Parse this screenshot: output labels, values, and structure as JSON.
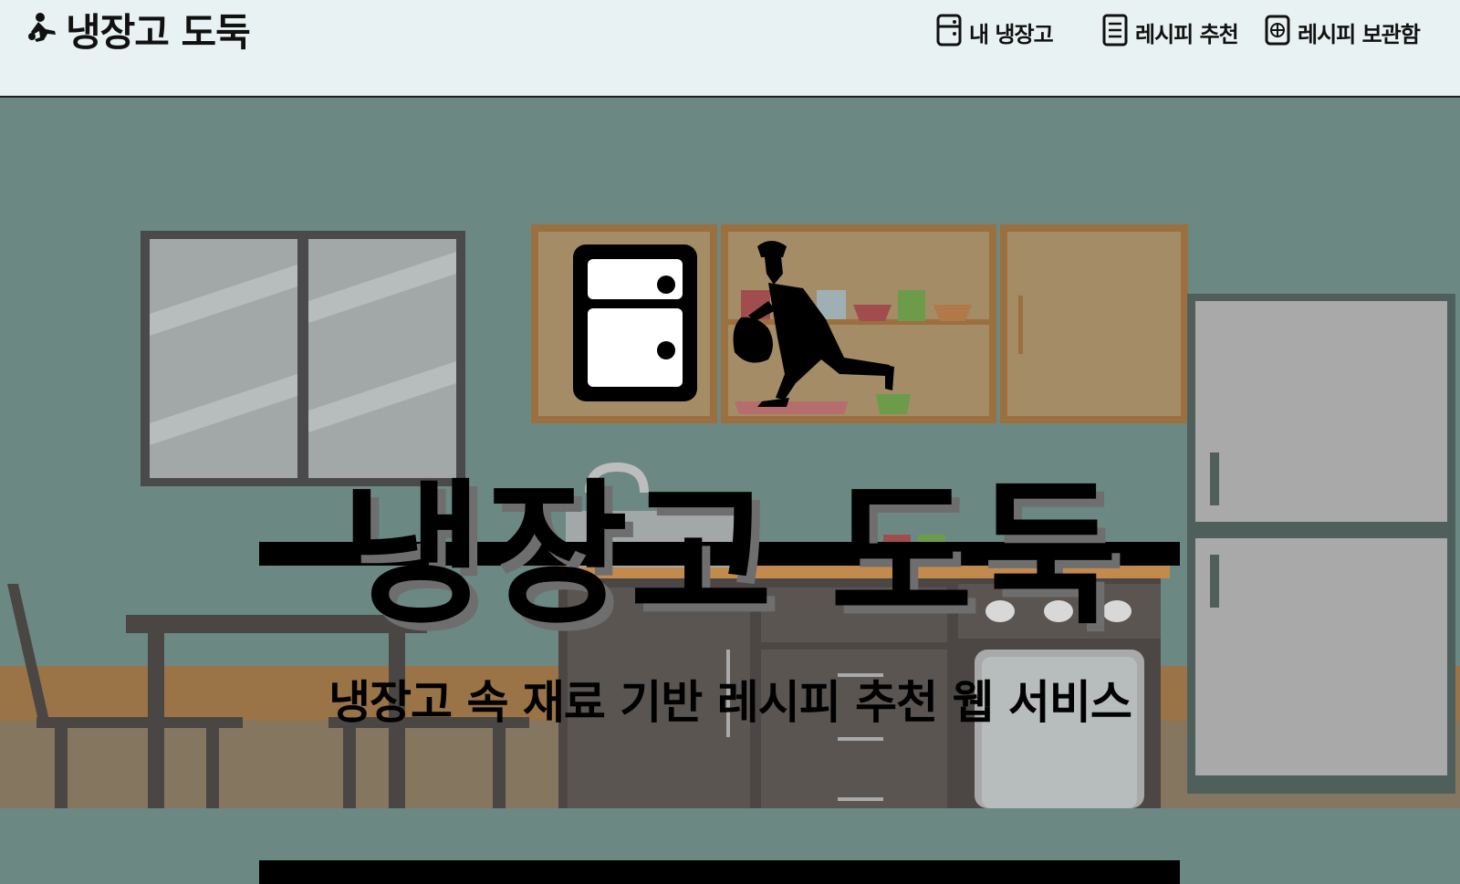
{
  "header": {
    "logo_text": "냉장고 도둑",
    "logo_icon": "running-thief-icon",
    "nav": [
      {
        "label": "내 냉장고",
        "icon": "fridge-icon"
      },
      {
        "label": "레시피 추천",
        "icon": "document-icon"
      },
      {
        "label": "레시피 보관함",
        "icon": "plus-box-icon"
      }
    ]
  },
  "hero": {
    "title": "냉장고 도둑",
    "subtitle": "냉장고 속 재료 기반 레시피 추천 웹 서비스"
  },
  "colors": {
    "header_bg": "#e9f2f2",
    "wall": "#6b8883",
    "cabinet": "#a38c66",
    "cabinet_frame": "#9c6f3f",
    "fridge": "#a9a9a9",
    "floor_stripe": "#9a7346",
    "text": "#000000"
  }
}
